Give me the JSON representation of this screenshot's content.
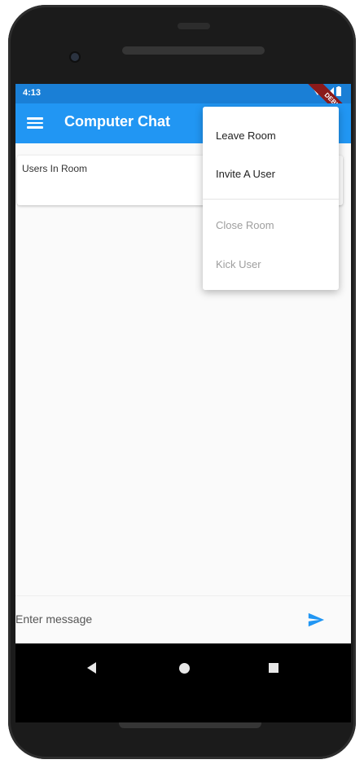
{
  "status_bar": {
    "time": "4:13",
    "debug_label": "DEBUG"
  },
  "app_bar": {
    "title": "Computer Chat",
    "menu_icon": "hamburger-menu-icon"
  },
  "users_card": {
    "label": "Users In Room"
  },
  "popup_menu": {
    "items": [
      {
        "label": "Leave Room",
        "enabled": true
      },
      {
        "label": "Invite A User",
        "enabled": true
      },
      {
        "label": "Close Room",
        "enabled": false
      },
      {
        "label": "Kick User",
        "enabled": false
      }
    ]
  },
  "composer": {
    "placeholder": "Enter message",
    "send_icon": "send-icon"
  },
  "nav_bar": {
    "back_icon": "back-triangle-icon",
    "home_icon": "home-circle-icon",
    "recents_icon": "recents-square-icon"
  },
  "colors": {
    "primary": "#2196f3",
    "status_bar": "#1a7fd6",
    "accent": "#2196f3",
    "background": "#fafafa"
  }
}
